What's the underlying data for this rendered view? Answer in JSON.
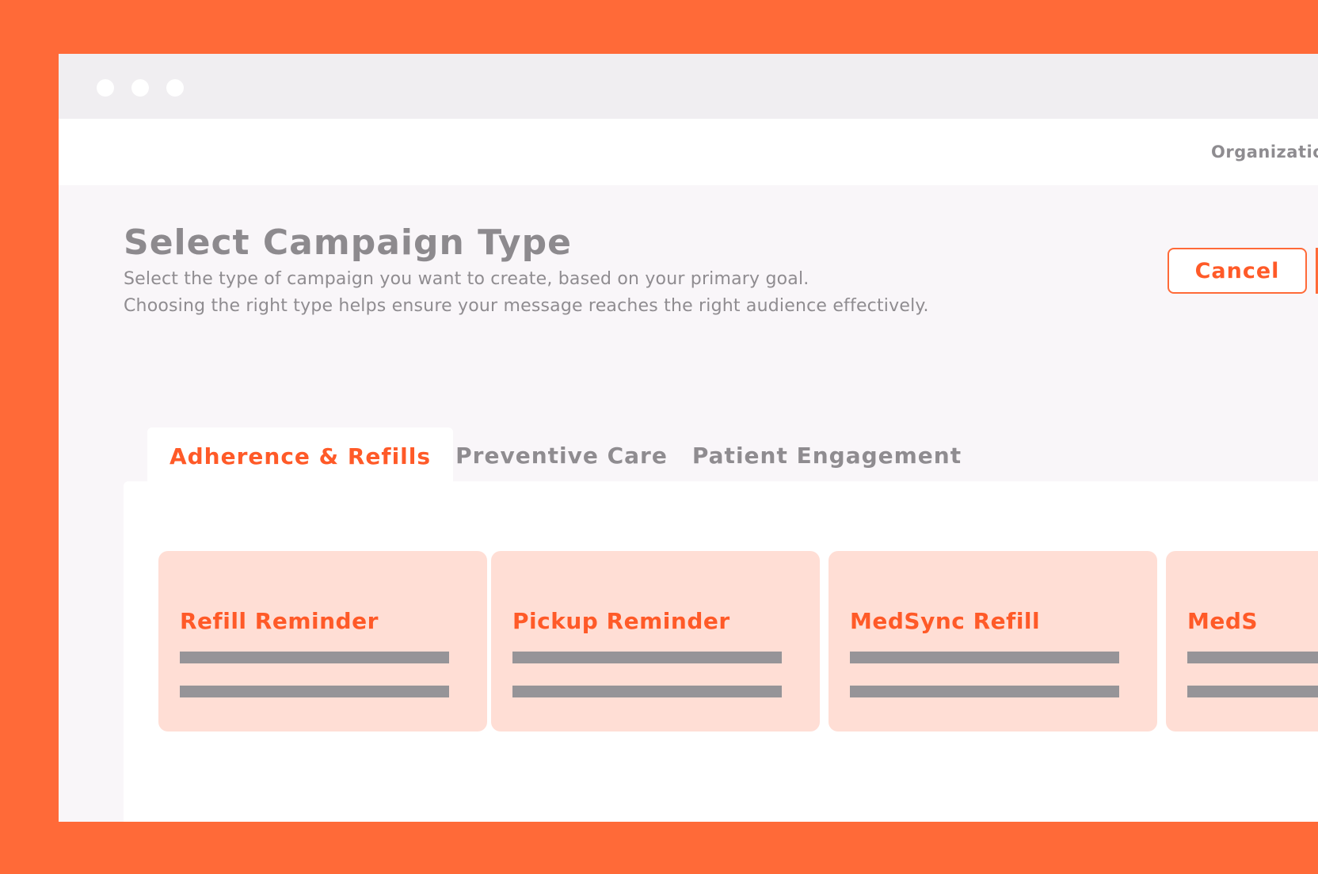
{
  "header": {
    "organization_label": "Organizatio"
  },
  "page": {
    "title": "Select Campaign Type",
    "description_line1": "Select the type of campaign you want to create, based on your primary goal.",
    "description_line2": "Choosing the right type helps ensure your message reaches the right audience effectively.",
    "cancel_label": "Cancel"
  },
  "tabs": [
    {
      "label": "Adherence & Refills",
      "active": true
    },
    {
      "label": "Preventive Care",
      "active": false
    },
    {
      "label": "Patient Engagement",
      "active": false
    }
  ],
  "cards": [
    {
      "title": "Refill Reminder"
    },
    {
      "title": "Pickup Reminder"
    },
    {
      "title": "MedSync Refill"
    },
    {
      "title": "MedS"
    }
  ],
  "colors": {
    "background": "#FF6A38",
    "accent": "#FF5A28",
    "card": "#FFDED5",
    "muted_text": "#8F8C90",
    "placeholder_bar": "#969498"
  }
}
